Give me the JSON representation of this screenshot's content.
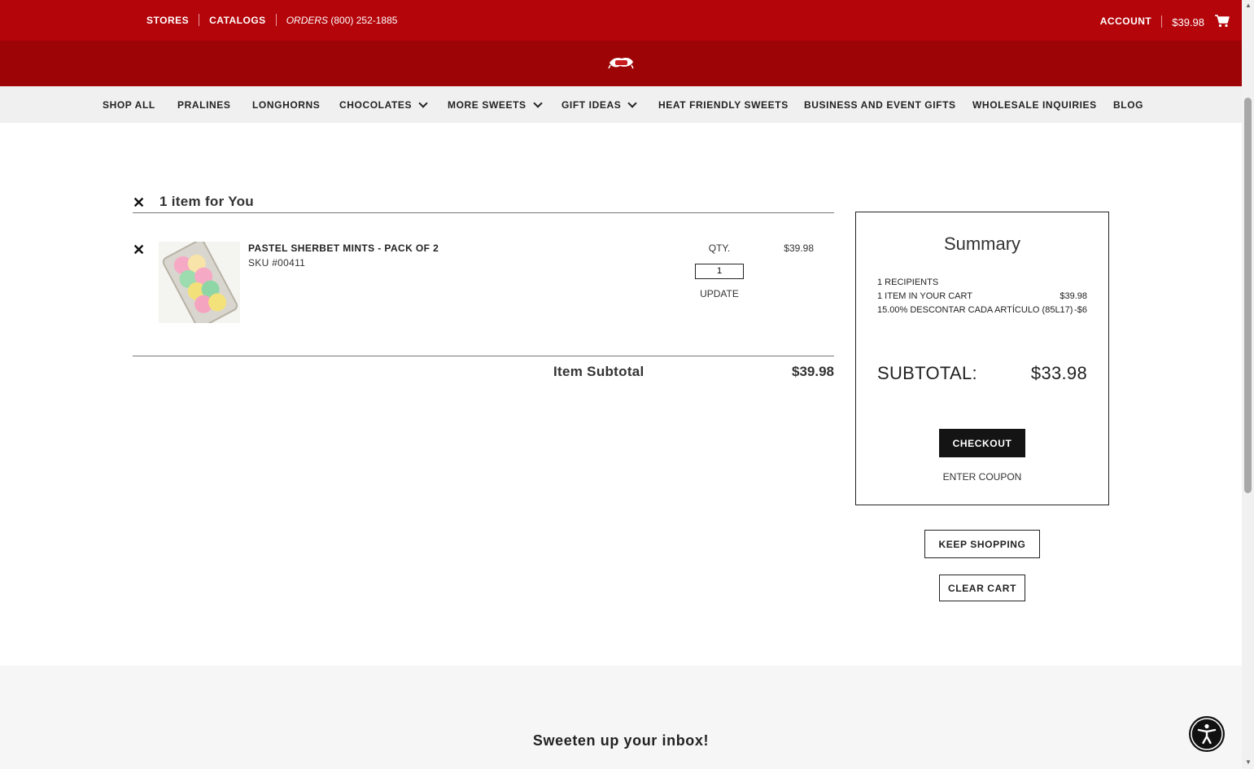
{
  "topbar": {
    "stores": "STORES",
    "catalogs": "CATALOGS",
    "orders_label": "ORDERS",
    "orders_phone": "(800) 252-1885",
    "account": "ACCOUNT",
    "cart_total": "$39.98",
    "cart_icon": "shopping-cart-icon"
  },
  "logo": {
    "icon": "brand-logo"
  },
  "nav": [
    {
      "label": "SHOP ALL",
      "dropdown": false
    },
    {
      "label": "PRALINES",
      "dropdown": false
    },
    {
      "label": "LONGHORNS",
      "dropdown": false
    },
    {
      "label": "CHOCOLATES",
      "dropdown": true
    },
    {
      "label": "MORE SWEETS",
      "dropdown": true
    },
    {
      "label": "GIFT IDEAS",
      "dropdown": true
    },
    {
      "label": "HEAT FRIENDLY SWEETS",
      "dropdown": false
    },
    {
      "label": "BUSINESS AND EVENT GIFTS",
      "dropdown": false
    },
    {
      "label": "WHOLESALE INQUIRIES",
      "dropdown": false
    },
    {
      "label": "BLOG",
      "dropdown": false
    }
  ],
  "cart": {
    "group_title": "1 item for You",
    "item": {
      "name": "PASTEL SHERBET MINTS - PACK OF 2",
      "sku": "SKU #00411",
      "qty_label": "QTY.",
      "qty": "1",
      "update": "UPDATE",
      "price": "$39.98"
    },
    "item_subtotal_label": "Item Subtotal",
    "item_subtotal": "$39.98"
  },
  "summary": {
    "title": "Summary",
    "recipients": "1 RECIPIENTS",
    "items_label": "1 ITEM IN YOUR CART",
    "items_value": "$39.98",
    "discount_label": "15.00% DESCONTAR CADA ARTÍCULO (85L17)",
    "discount_value": "-$6",
    "subtotal_label": "SUBTOTAL:",
    "subtotal_value": "$33.98",
    "checkout": "CHECKOUT",
    "coupon": "ENTER COUPON"
  },
  "actions": {
    "keep_shopping": "KEEP SHOPPING",
    "clear_cart": "CLEAR CART"
  },
  "footer": {
    "newsletter": "Sweeten up your inbox!"
  },
  "colors": {
    "topbar": "#b4050a",
    "logoband": "#9d0406",
    "nav_bg": "#f0f0f0",
    "checkout_bg": "#141414"
  }
}
